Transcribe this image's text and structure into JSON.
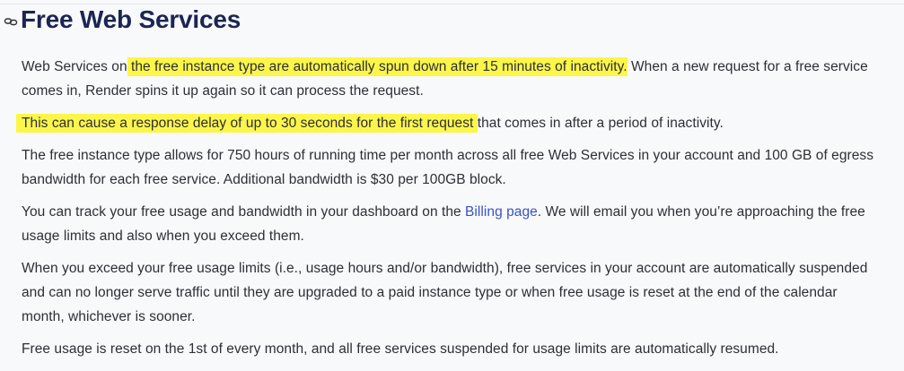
{
  "section": {
    "title": "Free Web Services",
    "anchor_icon": "link-icon"
  },
  "paragraphs": {
    "p1": {
      "before": "Web Services on",
      "highlight": " the free instance type are automatically spun down after 15 minutes of inactivity.",
      "after": " When a new request for a free service comes in, Render spins it up again so it can process the request."
    },
    "p2": {
      "highlight": "This can cause a response delay of up to 30 seconds for the first request ",
      "after": "that comes in after a period of inactivity."
    },
    "p3": {
      "text": "The free instance type allows for 750 hours of running time per month across all free Web Services in your account and 100 GB of egress bandwidth for each free service. Additional bandwidth is $30 per 100GB block."
    },
    "p4": {
      "before": "You can track your free usage and bandwidth in your dashboard on the ",
      "link": "Billing page",
      "after": ". We will email you when you’re approaching the free usage limits and also when you exceed them."
    },
    "p5": {
      "text": "When you exceed your free usage limits (i.e., usage hours and/or bandwidth), free services in your account are automatically suspended and can no longer serve traffic until they are upgraded to a paid instance type or when free usage is reset at the end of the calendar month, whichever is sooner."
    },
    "p6": {
      "text": "Free usage is reset on the 1st of every month, and all free services suspended for usage limits are automatically resumed."
    }
  },
  "colors": {
    "heading": "#1c2552",
    "body_text": "#2e2e36",
    "link": "#3a52c4",
    "highlight": "#fcf64a",
    "background": "#f8f9fb"
  }
}
